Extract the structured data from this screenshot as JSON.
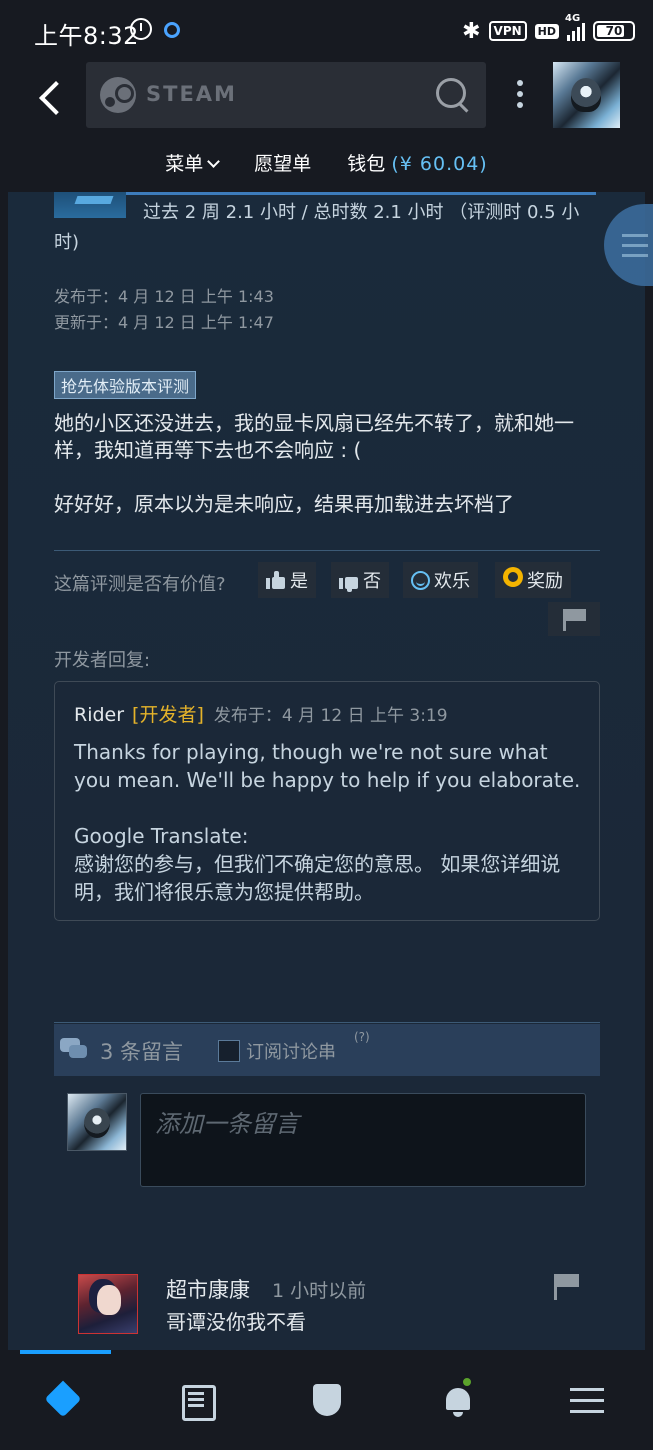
{
  "statusbar": {
    "time": "上午8:32",
    "vpn": "VPN",
    "hd": "HD",
    "net": "4G",
    "battery": "70"
  },
  "header": {
    "search_brand": "STEAM",
    "subnav": {
      "menu": "菜单",
      "wishlist": "愿望单",
      "wallet": "钱包",
      "wallet_amount": "(¥ 60.04)"
    }
  },
  "review": {
    "playtime": "过去 2 周 2.1 小时 / 总时数 2.1 小时 （评测时 0.5 小时)",
    "posted": "发布于：4 月 12 日 上午 1:43",
    "updated": "更新于：4 月 12 日 上午 1:47",
    "tag": "抢先体验版本评测",
    "paragraph1": "她的小区还没进去，我的显卡风扇已经先不转了，就和她一样，我知道再等下去也不会响应 : (",
    "paragraph2": "好好好，原本以为是未响应，结果再加载进去坏档了",
    "helpful_question": "这篇评测是否有价值?",
    "vote_yes": "是",
    "vote_no": "否",
    "vote_funny": "欢乐",
    "vote_award": "奖励"
  },
  "developer_reply": {
    "label": "开发者回复:",
    "name": "Rider",
    "tag": "[开发者]",
    "time": "发布于：4 月 12 日 上午 3:19",
    "text_en": "Thanks for playing, though we're not sure what you mean. We'll be happy to help if you elaborate.",
    "text_translate_label": "Google Translate:",
    "text_zh": "感谢您的参与，但我们不确定您的意思。 如果您详细说明，我们将很乐意为您提供帮助。"
  },
  "comments": {
    "count_label": "3 条留言",
    "subscribe_label": "订阅讨论串",
    "subscribe_help": "(?)",
    "input_placeholder": "添加一条留言",
    "items": [
      {
        "author": "超市康康",
        "time": "1 小时以前",
        "text": "哥谭没你我不看"
      }
    ]
  },
  "colors": {
    "accent": "#1a9fff",
    "link": "#66c0f4",
    "developer_tag": "#e5b32a",
    "background": "#1b2838"
  },
  "icons": {
    "tabs": [
      "tag-icon",
      "news-icon",
      "shield-icon",
      "bell-icon",
      "menu-icon"
    ]
  }
}
